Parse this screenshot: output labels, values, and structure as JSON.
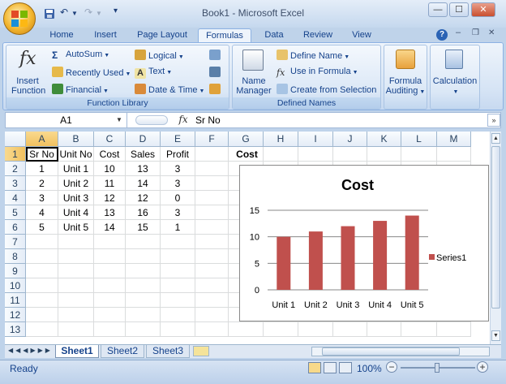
{
  "window": {
    "title": "Book1 - Microsoft Excel",
    "minimize": "—",
    "maximize": "☐",
    "close": "✕"
  },
  "qat": {
    "undo": "↶",
    "redo": "↷",
    "customize": "▾"
  },
  "tabs": [
    {
      "label": "Home"
    },
    {
      "label": "Insert"
    },
    {
      "label": "Page Layout"
    },
    {
      "label": "Formulas",
      "active": true
    },
    {
      "label": "Data"
    },
    {
      "label": "Review"
    },
    {
      "label": "View"
    }
  ],
  "ribbon": {
    "function_library": {
      "label": "Function Library",
      "insert_function": "Insert Function",
      "insert_function_line1": "Insert",
      "insert_function_line2": "Function",
      "autosum": "AutoSum",
      "recently_used": "Recently Used",
      "financial": "Financial",
      "logical": "Logical",
      "text": "Text",
      "date_time": "Date & Time"
    },
    "defined_names": {
      "label": "Defined Names",
      "name_manager_line1": "Name",
      "name_manager_line2": "Manager",
      "define_name": "Define Name",
      "use_in_formula": "Use in Formula",
      "create_from_selection": "Create from Selection"
    },
    "formula_auditing": {
      "line1": "Formula",
      "line2": "Auditing"
    },
    "calculation": {
      "label": "Calculation"
    }
  },
  "formula_bar": {
    "name_box": "A1",
    "fx": "fx",
    "content": "Sr No"
  },
  "sheet": {
    "columns": [
      "A",
      "B",
      "C",
      "D",
      "E",
      "F",
      "G",
      "H",
      "I",
      "J",
      "K",
      "L",
      "M"
    ],
    "rows": [
      "1",
      "2",
      "3",
      "4",
      "5",
      "6",
      "7",
      "8",
      "9",
      "10",
      "11",
      "12",
      "13"
    ],
    "headers": [
      "Sr No",
      "Unit No",
      "Cost",
      "Sales",
      "Profit"
    ],
    "data": [
      [
        "1",
        "Unit 1",
        "10",
        "13",
        "3"
      ],
      [
        "2",
        "Unit 2",
        "11",
        "14",
        "3"
      ],
      [
        "3",
        "Unit 3",
        "12",
        "12",
        "0"
      ],
      [
        "4",
        "Unit 4",
        "13",
        "16",
        "3"
      ],
      [
        "5",
        "Unit 5",
        "14",
        "15",
        "1"
      ]
    ],
    "g1": "Cost"
  },
  "chart_data": {
    "type": "bar",
    "title": "Cost",
    "categories": [
      "Unit 1",
      "Unit 2",
      "Unit 3",
      "Unit 4",
      "Unit 5"
    ],
    "series": [
      {
        "name": "Series1",
        "values": [
          10,
          11,
          12,
          13,
          14
        ],
        "color": "#c0504d"
      }
    ],
    "ylim": [
      0,
      15
    ],
    "yticks": [
      "0",
      "5",
      "10",
      "15"
    ],
    "grid": true,
    "legend": "right"
  },
  "sheet_tabs": [
    "Sheet1",
    "Sheet2",
    "Sheet3"
  ],
  "status": {
    "ready": "Ready",
    "zoom": "100%"
  }
}
